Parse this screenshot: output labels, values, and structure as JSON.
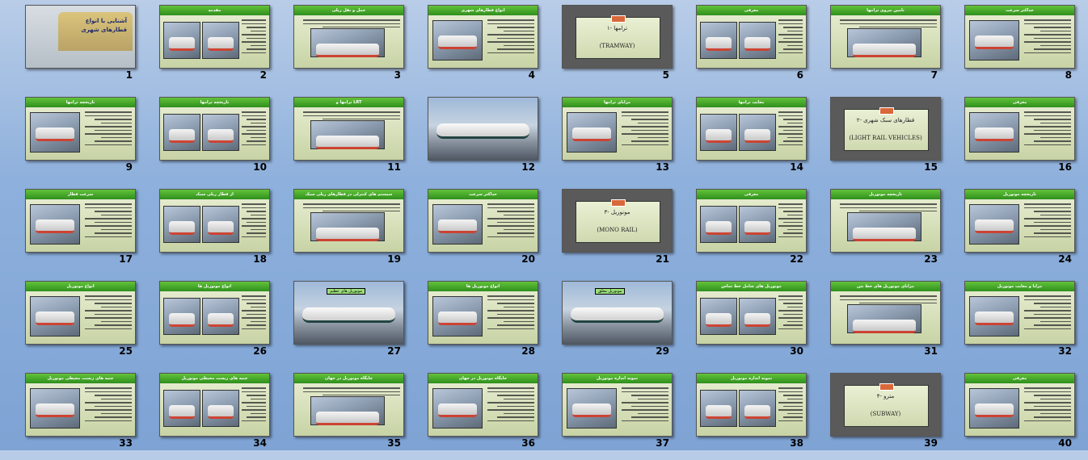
{
  "slides": [
    {
      "n": "1",
      "kind": "title",
      "title": "آشنایی با انواع قطارهای شهری"
    },
    {
      "n": "2",
      "kind": "content",
      "title": "مقدمه"
    },
    {
      "n": "3",
      "kind": "content",
      "title": "حمل و نقل ریلی"
    },
    {
      "n": "4",
      "kind": "content",
      "title": "انواع قطارهای شهری"
    },
    {
      "n": "5",
      "kind": "section",
      "line1": "۱- ترامها",
      "line2": "(TRAMWAY)"
    },
    {
      "n": "6",
      "kind": "content",
      "title": "معرفی"
    },
    {
      "n": "7",
      "kind": "content",
      "title": "تامین نیروی ترامها"
    },
    {
      "n": "8",
      "kind": "content",
      "title": "حداکثر سرعت"
    },
    {
      "n": "9",
      "kind": "content",
      "title": "تاریخچه ترامها"
    },
    {
      "n": "10",
      "kind": "content",
      "title": "تاریخچه ترامها"
    },
    {
      "n": "11",
      "kind": "content",
      "title": "ترامها و LRT"
    },
    {
      "n": "12",
      "kind": "photo",
      "title": ""
    },
    {
      "n": "13",
      "kind": "content",
      "title": "مزایای ترامها"
    },
    {
      "n": "14",
      "kind": "content",
      "title": "معایب ترامها"
    },
    {
      "n": "15",
      "kind": "section",
      "line1": "۲- قطارهای سبک شهری",
      "line2": "(LIGHT RAIL VEHICLES)"
    },
    {
      "n": "16",
      "kind": "content",
      "title": "معرفی"
    },
    {
      "n": "17",
      "kind": "content",
      "title": "سرعت قطار"
    },
    {
      "n": "18",
      "kind": "content",
      "title": "از قطار ریلی سبک"
    },
    {
      "n": "19",
      "kind": "content",
      "title": "سیستم های کنترلی در قطارهای ریلی سبک"
    },
    {
      "n": "20",
      "kind": "content",
      "title": "حداکثر سرعت"
    },
    {
      "n": "21",
      "kind": "section",
      "line1": "۳- مونوریل",
      "line2": "(MONO RAIL)"
    },
    {
      "n": "22",
      "kind": "content",
      "title": "معرفی"
    },
    {
      "n": "23",
      "kind": "content",
      "title": "تاریخچه مونوریل"
    },
    {
      "n": "24",
      "kind": "content",
      "title": "تاریخچه مونوریل"
    },
    {
      "n": "25",
      "kind": "content",
      "title": "انواع مونوریل"
    },
    {
      "n": "26",
      "kind": "content",
      "title": "انواع مونوریل ها"
    },
    {
      "n": "27",
      "kind": "photo",
      "title": "مونوریل های عظیم"
    },
    {
      "n": "28",
      "kind": "content",
      "title": "انواع مونوریل ها"
    },
    {
      "n": "29",
      "kind": "photo",
      "title": "مونوریل معلق"
    },
    {
      "n": "30",
      "kind": "content",
      "title": "مونوریل های شامل خط تماس"
    },
    {
      "n": "31",
      "kind": "content",
      "title": "مزایای مونوریل های خط بتن"
    },
    {
      "n": "32",
      "kind": "content",
      "title": "مزایا و معایب مونوریل"
    },
    {
      "n": "33",
      "kind": "content",
      "title": "جنبه های زیست محیطی مونوریل"
    },
    {
      "n": "34",
      "kind": "content",
      "title": "جنبه های زیست محیطی مونوریل"
    },
    {
      "n": "35",
      "kind": "content",
      "title": "جایگاه مونوریل در جهان"
    },
    {
      "n": "36",
      "kind": "content",
      "title": "جایگاه مونوریل در جهان"
    },
    {
      "n": "37",
      "kind": "content",
      "title": "نمونه اندازه مونوریل"
    },
    {
      "n": "38",
      "kind": "content",
      "title": "نمونه اندازه مونوریل"
    },
    {
      "n": "39",
      "kind": "section",
      "line1": "۴- مترو",
      "line2": "(SUBWAY)"
    },
    {
      "n": "40",
      "kind": "content",
      "title": "معرفی"
    }
  ]
}
